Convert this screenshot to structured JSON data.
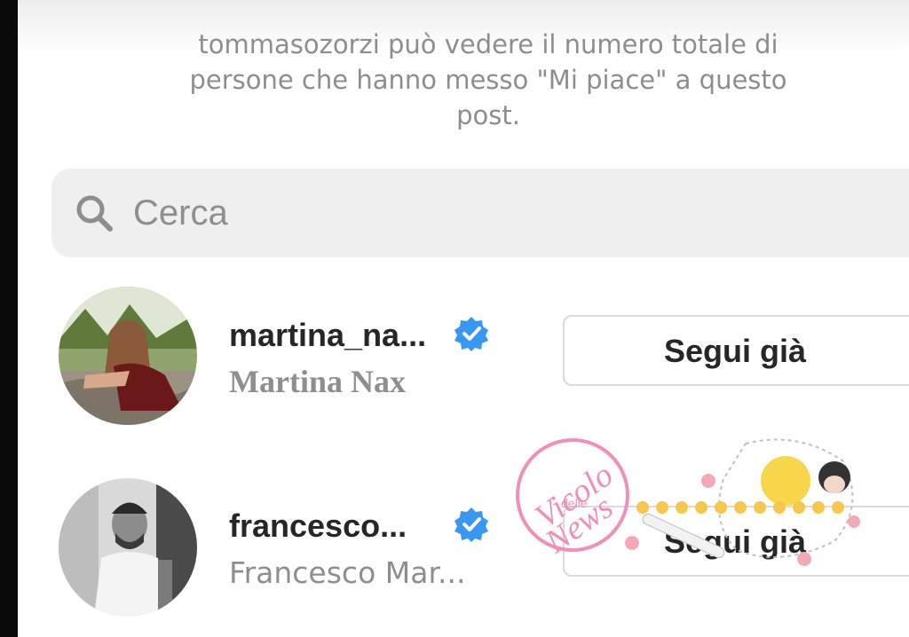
{
  "notice": {
    "line1": "tommasozorzi può vedere il numero totale di",
    "line2": "persone che hanno messo \"Mi piace\" a questo",
    "line3": "post."
  },
  "search": {
    "placeholder": "Cerca",
    "icon": "search-icon"
  },
  "users": [
    {
      "username": "martina_na...",
      "full_name": "Martina Nax",
      "verified": true,
      "button_label": "Segui già"
    },
    {
      "username": "francesco...",
      "full_name": "Francesco Mar...",
      "verified": true,
      "button_label": "Segui già"
    }
  ],
  "watermark": {
    "line1": "Vicolo",
    "line2": "delle",
    "line3": "News"
  },
  "colors": {
    "verified_blue": "#3897f0",
    "secondary_text": "#8e8e8e",
    "primary_text": "#262626",
    "watermark_pink": "#f08fb8"
  }
}
